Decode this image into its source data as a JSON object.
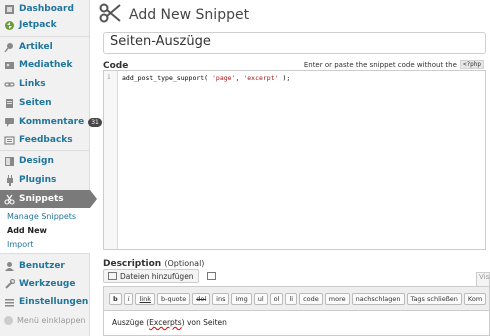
{
  "sidebar": {
    "items": [
      {
        "label": "Dashboard",
        "icon": "dashboard-icon"
      },
      {
        "label": "Jetpack",
        "icon": "jetpack-icon"
      },
      {
        "label": "Artikel",
        "icon": "pin-icon"
      },
      {
        "label": "Mediathek",
        "icon": "media-icon"
      },
      {
        "label": "Links",
        "icon": "link-icon"
      },
      {
        "label": "Seiten",
        "icon": "page-icon"
      },
      {
        "label": "Kommentare",
        "icon": "comment-icon",
        "badge": "31"
      },
      {
        "label": "Feedbacks",
        "icon": "feedback-icon"
      },
      {
        "label": "Design",
        "icon": "appearance-icon"
      },
      {
        "label": "Plugins",
        "icon": "plugin-icon"
      },
      {
        "label": "Snippets",
        "icon": "scissors-icon",
        "active": true
      },
      {
        "label": "Benutzer",
        "icon": "users-icon"
      },
      {
        "label": "Werkzeuge",
        "icon": "tools-icon"
      },
      {
        "label": "Einstellungen",
        "icon": "settings-icon"
      }
    ],
    "submenu": [
      {
        "label": "Manage Snippets"
      },
      {
        "label": "Add New"
      },
      {
        "label": "Import"
      }
    ],
    "collapse_label": "Menü einklappen"
  },
  "page": {
    "title": "Add New Snippet",
    "snippet_name": "Seiten-Auszüge",
    "code_label": "Code",
    "code_hint": "Enter or paste the snippet code without the",
    "code_hint_tag": "<?php",
    "code_line_number": "1",
    "code_text_prefix": "add_post_type_support( ",
    "code_text_str1": "'page'",
    "code_text_mid": ", ",
    "code_text_str2": "'excerpt'",
    "code_text_suffix": " );",
    "description_label": "Description",
    "description_optional": "(Optional)",
    "media_button": "Dateien hinzufügen",
    "visual_tab": "Vis",
    "quicktags": [
      "b",
      "i",
      "link",
      "b-quote",
      "del",
      "ins",
      "img",
      "ul",
      "ol",
      "li",
      "code",
      "more",
      "nachschlagen",
      "Tags schließen",
      "Kom"
    ],
    "editor_text_before": "Auszüge (",
    "editor_text_spell": "Excerpts",
    "editor_text_after": ") von Seiten"
  },
  "colors": {
    "link": "#21759b",
    "active_menu": "#7a7a7a",
    "sidebar_bg": "#f1f1f1"
  }
}
